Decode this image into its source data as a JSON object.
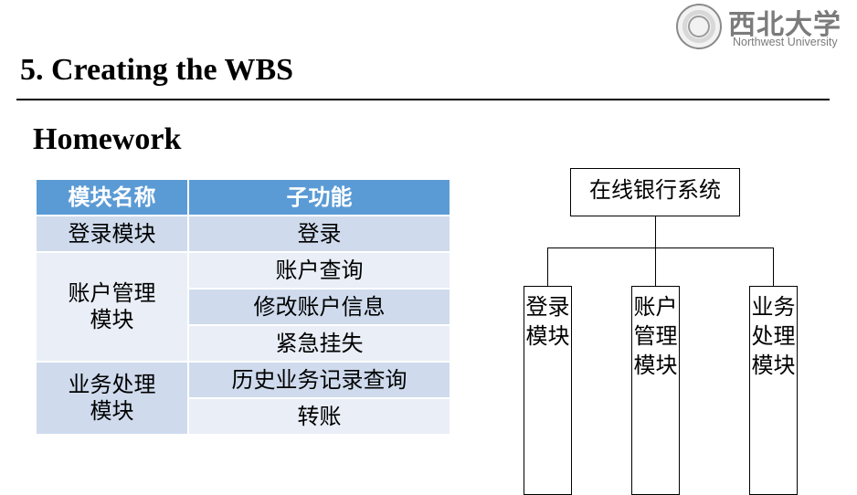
{
  "logo": {
    "chinese_name": "西北大学",
    "english_name": "Northwest University"
  },
  "slide": {
    "title": "5. Creating the WBS",
    "subtitle": "Homework"
  },
  "table": {
    "headers": [
      "模块名称",
      "子功能"
    ],
    "groups": [
      {
        "module": "登录模块",
        "functions": [
          "登录"
        ]
      },
      {
        "module": "账户管理模块",
        "functions": [
          "账户查询",
          "修改账户信息",
          "紧急挂失"
        ]
      },
      {
        "module": "业务处理模块",
        "functions": [
          "历史业务记录查询",
          "转账"
        ]
      }
    ]
  },
  "wbs": {
    "root": "在线银行系统",
    "children": [
      "登录模块",
      "账户管理模块",
      "业务处理模块"
    ]
  }
}
